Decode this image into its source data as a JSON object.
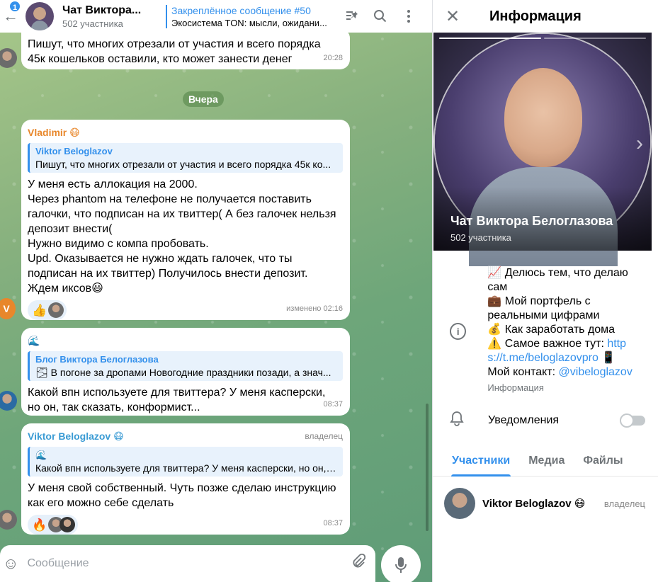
{
  "header": {
    "back_badge": "1",
    "title": "Чат Виктора...",
    "subtitle": "502 участника",
    "pinned_title": "Закреплённое сообщение #50",
    "pinned_text": "Экосистема TON: мысли, ожидани..."
  },
  "messages": {
    "m0": {
      "text_lines": [
        "Пишут, что многих отрезали от участия и всего порядка",
        "45к кошельков оставили, кто может занести денег"
      ],
      "time": "20:28"
    },
    "date_chip": "Вчера",
    "m1": {
      "author": "Vladimir",
      "author_emoji": "😷",
      "reply_name": "Viktor Beloglazov",
      "reply_text": "Пишут, что многих отрезали от участия и всего порядка 45к ко...",
      "text_lines": [
        "У меня есть аллокация на 2000.",
        "Через phantom на телефоне не получается поставить",
        "галочки, что подписан на их твиттер( А без галочек нельзя",
        "депозит внести(",
        "Нужно видимо с компа пробовать.",
        "Upd. Оказывается не нужно ждать галочек, что ты",
        "подписан на их твиттер) Получилось внести депозит.",
        "Ждем иксов😃"
      ],
      "reaction_emoji": "👍",
      "time": "изменено 02:16",
      "avatar_letter": "V"
    },
    "m2": {
      "author_emoji": "🌊",
      "reply_name": "Блог Виктора Белоглазова",
      "reply_text": "🌫 В погоне за дропами Новогодние праздники позади, а знач...",
      "text_lines": [
        "Какой впн используете для твиттера? У меня касперски,",
        "но он, так сказать, конформист..."
      ],
      "time": "08:37"
    },
    "m3": {
      "author": "Viktor Beloglazov",
      "author_emoji": "😷",
      "owner_tag": "владелец",
      "reply_name": "🌊",
      "reply_text": "Какой впн используете для твиттера? У меня касперски, но он, ...",
      "text_lines": [
        "У меня свой собственный. Чуть позже сделаю инструкцию",
        "как его можно себе сделать"
      ],
      "reaction_emoji": "🔥",
      "time": "08:37"
    }
  },
  "composer": {
    "placeholder": "Сообщение"
  },
  "panel": {
    "title": "Информация",
    "photo_name": "Чат Виктора Белоглазова",
    "photo_count": "502 участника",
    "info_lines": [
      "📈 Делюсь тем, что делаю",
      "сам",
      "💼 Мой портфель с",
      "реальными цифрами",
      "💰 Как заработать дома",
      "⚠️ Самое важное тут: "
    ],
    "info_link1a": "http",
    "info_link1b": "s://t.me/beloglazovpro",
    "info_link1_suffix": " 📱",
    "info_contact_prefix": "Мой контакт: ",
    "info_contact": "@vibeloglazov",
    "info_label": "Информация",
    "notifications_label": "Уведомления",
    "tabs": [
      "Участники",
      "Медиа",
      "Файлы"
    ],
    "member_name": "Viktor Beloglazov",
    "member_emoji": "😷",
    "member_role": "владелец"
  },
  "colors": {
    "accent": "#3390ec",
    "vladimir": "#e8872b",
    "author_blue": "#3a9bd4"
  }
}
